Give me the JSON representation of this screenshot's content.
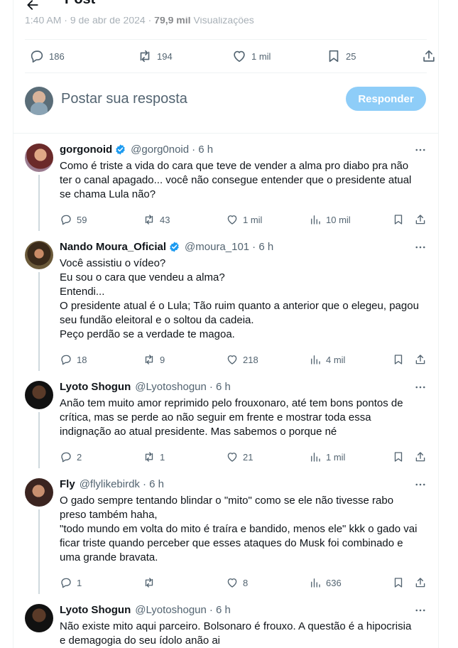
{
  "header": {
    "title": "Post"
  },
  "post_meta": {
    "time": "1:40 AM",
    "date": "9 de abr de 2024",
    "views_count": "79,9 mil",
    "views_label": "Visualizações"
  },
  "post_stats": {
    "replies": "186",
    "reposts": "194",
    "likes": "1 mil",
    "bookmarks": "25"
  },
  "reply_box": {
    "placeholder": "Postar sua resposta",
    "button": "Responder"
  },
  "replies": [
    {
      "name": "gorgonoid",
      "verified": true,
      "handle": "@gorg0noid",
      "time": "· 6 h",
      "lines": [
        "Como é triste a vida do cara que teve de vender a alma pro diabo pra não",
        "ter o canal apagado... você não consegue entender que o presidente atual",
        "se chama Lula não?"
      ],
      "replies": "59",
      "reposts": "43",
      "likes": "1 mil",
      "views": "10 mil"
    },
    {
      "name": "Nando Moura_Oficial",
      "verified": true,
      "handle": "@moura_101",
      "time": "· 6 h",
      "lines": [
        "Você assistiu o vídeo?",
        "Eu sou o cara que vendeu a alma?",
        "Entendi...",
        "O presidente atual é o Lula; Tão ruim quanto a anterior que o elegeu, pagou",
        "seu fundão eleitoral e o soltou da cadeia.",
        "Peço perdão se a verdade te magoa."
      ],
      "replies": "18",
      "reposts": "9",
      "likes": "218",
      "views": "4 mil"
    },
    {
      "name": "Lyoto Shogun",
      "verified": false,
      "handle": "@Lyotoshogun",
      "time": "· 6 h",
      "lines": [
        "Anão tem muito amor reprimido pelo frouxonaro, até tem bons pontos de",
        "crítica, mas se perde ao não seguir em frente e mostrar toda essa",
        "indignação ao atual presidente. Mas sabemos o porque né"
      ],
      "replies": "2",
      "reposts": "1",
      "likes": "21",
      "views": "1 mil"
    },
    {
      "name": "Fly",
      "verified": false,
      "handle": "@flylikebirdk",
      "time": "· 6 h",
      "lines": [
        "O gado sempre tentando blindar o \"mito\" como se ele não tivesse rabo",
        "preso também haha,",
        "\"todo mundo em volta do mito é traíra e bandido, menos ele\" kkk o gado vai",
        "ficar triste quando perceber que esses ataques do Musk foi combinado e",
        "uma grande bravata."
      ],
      "replies": "1",
      "reposts": "",
      "likes": "8",
      "views": "636"
    },
    {
      "name": "Lyoto Shogun",
      "verified": false,
      "handle": "@Lyotoshogun",
      "time": "· 6 h",
      "lines": [
        "Não existe mito aqui parceiro. Bolsonaro é frouxo. A questão é a hipocrisia",
        "e demagogia do seu ídolo anão ai"
      ],
      "replies": "",
      "reposts": "",
      "likes": "",
      "views": ""
    }
  ],
  "colors": {
    "accent": "#1d9bf0",
    "reply_button": "#8ecdf8",
    "text": "#0f1419",
    "secondary": "#536471",
    "border": "#eff3f4",
    "verified": "#1d9bf0"
  },
  "icons": [
    "back-arrow-icon",
    "reply-icon",
    "repost-icon",
    "like-icon",
    "bookmark-icon",
    "share-icon",
    "views-icon",
    "more-icon",
    "verified-icon"
  ]
}
